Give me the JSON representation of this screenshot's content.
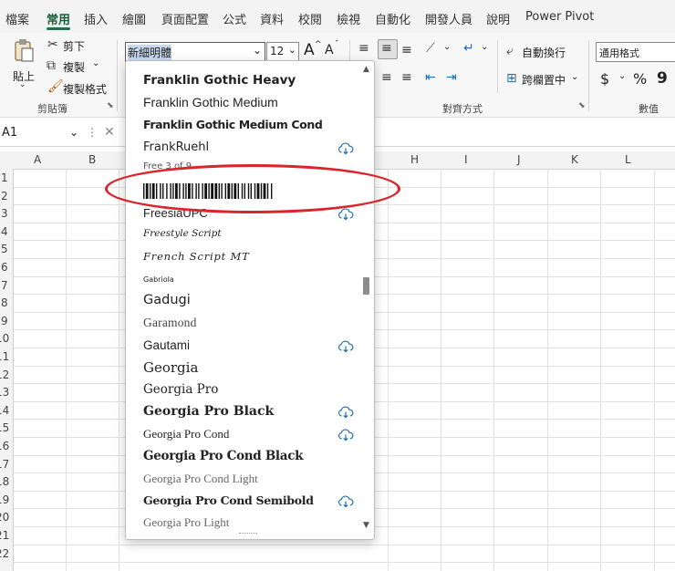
{
  "ribbon_tabs": [
    "檔案",
    "常用",
    "插入",
    "繪圖",
    "頁面配置",
    "公式",
    "資料",
    "校閱",
    "檢視",
    "自動化",
    "開發人員",
    "說明",
    "Power Pivot"
  ],
  "active_tab": "常用",
  "clipboard": {
    "paste_label": "貼上",
    "cut_label": "剪下",
    "copy_label": "複製",
    "format_painter_label": "複製格式",
    "group_label": "剪貼簿"
  },
  "font": {
    "font_name": "新細明體",
    "font_size": "12",
    "increase_label": "A",
    "decrease_label": "A"
  },
  "alignment": {
    "wrap_text_label": "自動換行",
    "merge_center_label": "跨欄置中",
    "group_label": "對齊方式"
  },
  "number": {
    "format_label": "通用格式",
    "currency_symbol": "$",
    "percent_symbol": "%",
    "comma_symbol": "9",
    "group_label": "數值"
  },
  "formula_bar": {
    "name_box": "A1",
    "cancel_symbol": "✕"
  },
  "grid": {
    "columns": [
      "A",
      "B",
      "H",
      "I",
      "J",
      "K",
      "L"
    ],
    "rows": [
      "1",
      "2",
      "3",
      "4",
      "5",
      "6",
      "7",
      "8",
      "9",
      "10",
      "11",
      "12",
      "13",
      "14",
      "15",
      "16",
      "17",
      "18",
      "19",
      "20",
      "21",
      "22"
    ]
  },
  "font_list": [
    {
      "name": "Franklin Gothic Heavy",
      "cloud": false
    },
    {
      "name": "Franklin Gothic Medium",
      "cloud": false
    },
    {
      "name": "Franklin Gothic Medium Cond",
      "cloud": false
    },
    {
      "name": "FrankRuehl",
      "cloud": true
    },
    {
      "name": "Free 3 of 9",
      "cloud": false
    },
    {
      "name": "FreesiaUPC",
      "cloud": true
    },
    {
      "name": "Freestyle Script",
      "cloud": false
    },
    {
      "name": "French Script MT",
      "cloud": false
    },
    {
      "name": "Gabriola",
      "cloud": false
    },
    {
      "name": "Gadugi",
      "cloud": false
    },
    {
      "name": "Garamond",
      "cloud": false
    },
    {
      "name": "Gautami",
      "cloud": true
    },
    {
      "name": "Georgia",
      "cloud": false
    },
    {
      "name": "Georgia Pro",
      "cloud": false
    },
    {
      "name": "Georgia Pro Black",
      "cloud": true
    },
    {
      "name": "Georgia Pro Cond",
      "cloud": true
    },
    {
      "name": "Georgia Pro Cond Black",
      "cloud": false
    },
    {
      "name": "Georgia Pro Cond Light",
      "cloud": false
    },
    {
      "name": "Georgia Pro Cond Semibold",
      "cloud": true
    },
    {
      "name": "Georgia Pro Light",
      "cloud": false
    }
  ],
  "colors": {
    "accent_green": "#1e7145",
    "highlight_red": "#d9262c",
    "cloud_blue": "#1f6fb2"
  },
  "icons": [
    "paste-icon",
    "scissors-icon",
    "copy-icon",
    "format-painter-icon",
    "dropdown-arrow-icon",
    "cloud-download-icon",
    "scroll-up-icon",
    "scroll-down-icon",
    "barcode-glyph"
  ]
}
